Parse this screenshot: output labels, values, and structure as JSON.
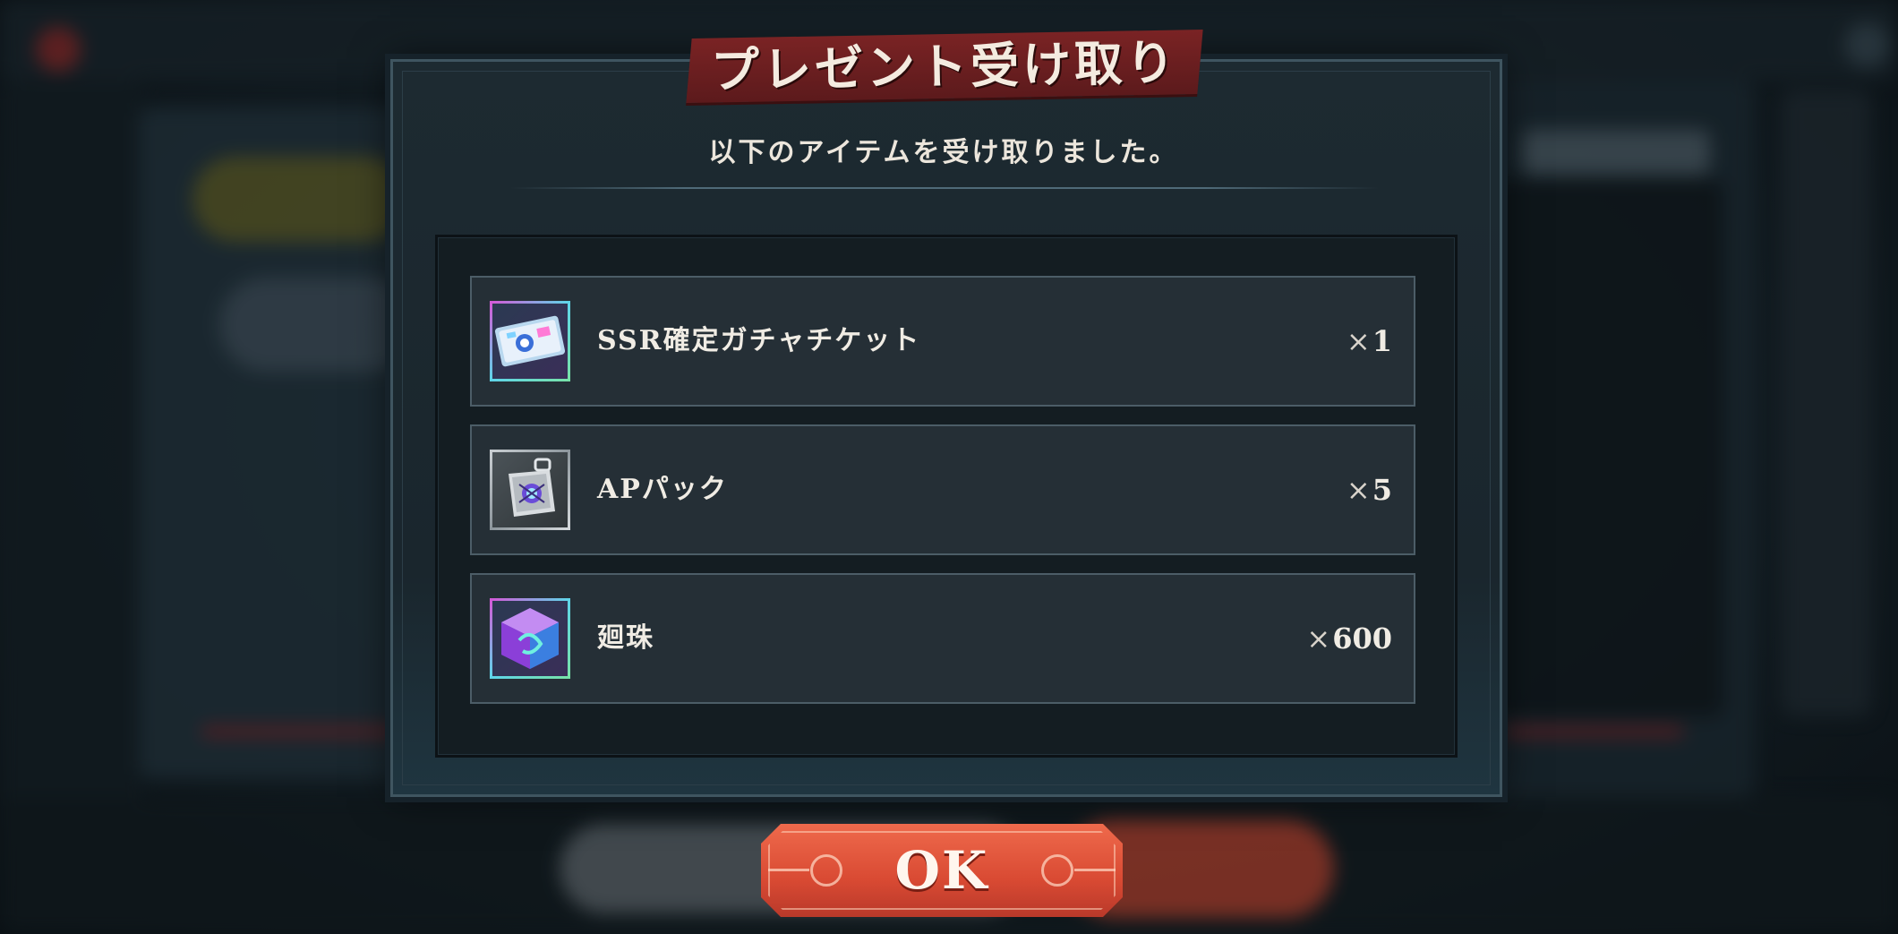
{
  "dialog": {
    "title": "プレゼント受け取り",
    "message": "以下のアイテムを受け取りました。",
    "items": [
      {
        "name": "SSR確定ガチャチケット",
        "qty_prefix": "×",
        "qty": "1",
        "icon": "gacha-ticket-icon"
      },
      {
        "name": "APパック",
        "qty_prefix": "×",
        "qty": "5",
        "icon": "ap-pack-icon"
      },
      {
        "name": "廻珠",
        "qty_prefix": "×",
        "qty": "600",
        "icon": "crystal-cube-icon"
      }
    ],
    "ok_label": "OK"
  },
  "colors": {
    "banner": "#6b1e20",
    "ok_button": "#e05a3e",
    "row_bg": "#252f36",
    "row_border": "#4c5d67"
  }
}
